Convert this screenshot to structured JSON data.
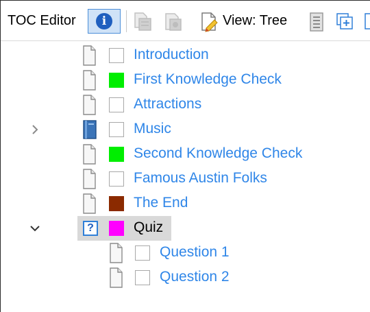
{
  "toolbar": {
    "title": "TOC Editor",
    "info_icon": "info-icon",
    "view_label": "View: Tree"
  },
  "colors": {
    "link": "#2f86e8",
    "green_status": "#00ee00",
    "brown_status": "#8b2a00",
    "magenta_status": "#ff00ff",
    "selection": "#d9d9d9"
  },
  "tree": {
    "items": [
      {
        "label": "Introduction",
        "icon": "page-icon",
        "status": "empty"
      },
      {
        "label": "First Knowledge Check",
        "icon": "page-icon",
        "status": "green"
      },
      {
        "label": "Attractions",
        "icon": "page-icon",
        "status": "empty"
      },
      {
        "label": "Music",
        "icon": "book-icon",
        "status": "empty",
        "expander": "collapsed"
      },
      {
        "label": "Second Knowledge Check",
        "icon": "page-icon",
        "status": "green"
      },
      {
        "label": "Famous Austin Folks",
        "icon": "page-icon",
        "status": "empty"
      },
      {
        "label": "The End",
        "icon": "page-icon",
        "status": "brown"
      },
      {
        "label": "Quiz",
        "icon": "question-icon",
        "status": "magenta",
        "expander": "expanded",
        "selected": true
      },
      {
        "label": "Question 1",
        "icon": "page-icon",
        "status": "empty"
      },
      {
        "label": "Question 2",
        "icon": "page-icon",
        "status": "empty"
      }
    ]
  }
}
